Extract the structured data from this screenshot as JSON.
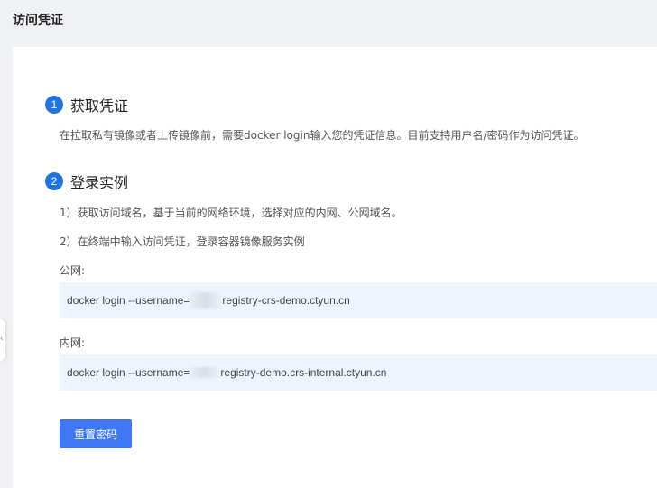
{
  "header": {
    "title": "访问凭证"
  },
  "steps": [
    {
      "number": "1",
      "title": "获取凭证"
    },
    {
      "number": "2",
      "title": "登录实例"
    }
  ],
  "step1": {
    "description": "在拉取私有镜像或者上传镜像前，需要docker login输入您的凭证信息。目前支持用户名/密码作为访问凭证。"
  },
  "step2": {
    "item1": "1）获取访问域名，基于当前的网络环境，选择对应的内网、公网域名。",
    "item2": "2）在终端中输入访问凭证，登录容器镜像服务实例",
    "public_label": "公网:",
    "public_cmd_prefix": "docker login --username=",
    "public_cmd_suffix": " registry-crs-demo.ctyun.cn",
    "internal_label": "内网:",
    "internal_cmd_prefix": "docker login --username=",
    "internal_cmd_suffix": " registry-demo.crs-internal.ctyun.cn"
  },
  "actions": {
    "reset_password": "重置密码"
  },
  "colors": {
    "accent": "#1f74dd",
    "button": "#3e78f5",
    "code_bg": "#eef4fe",
    "page_bg": "#f0f1f4"
  }
}
